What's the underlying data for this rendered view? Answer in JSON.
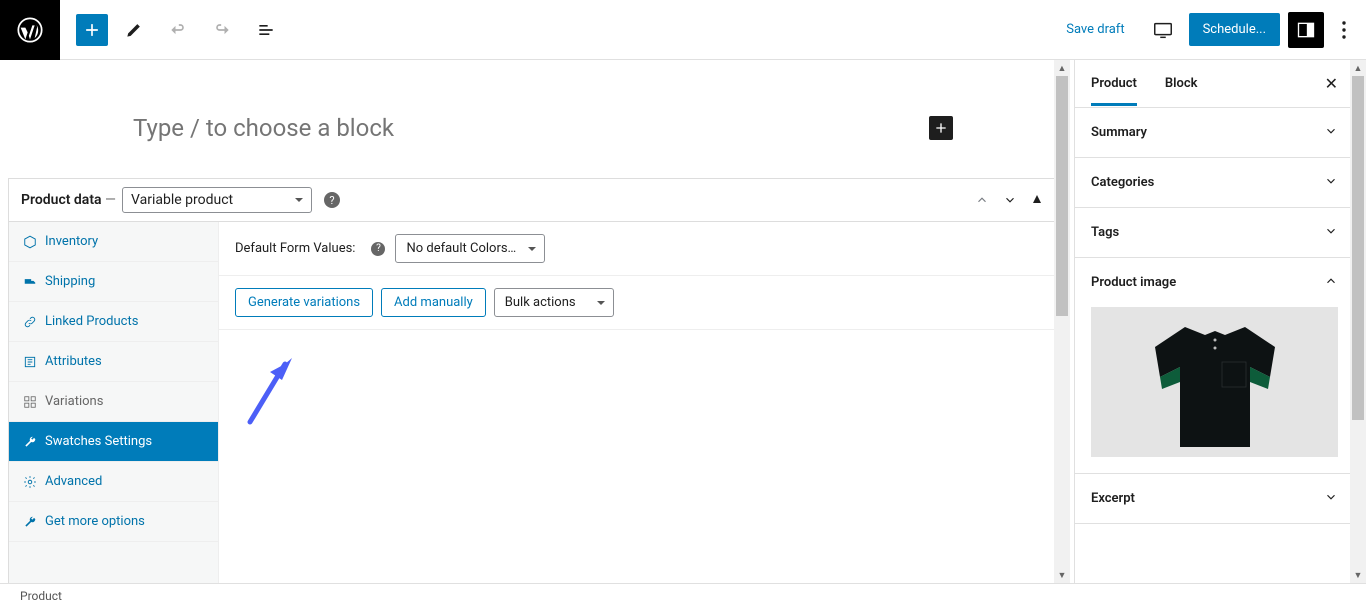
{
  "topbar": {
    "save_draft": "Save draft",
    "schedule": "Schedule..."
  },
  "block": {
    "placeholder": "Type / to choose a block"
  },
  "metabox": {
    "title": "Product data",
    "dash": "—",
    "product_type": "Variable product",
    "tabs": {
      "inventory": "Inventory",
      "shipping": "Shipping",
      "linked": "Linked Products",
      "attributes": "Attributes",
      "variations": "Variations",
      "swatches": "Swatches Settings",
      "advanced": "Advanced",
      "more": "Get more options"
    },
    "row": {
      "default_form": "Default Form Values:",
      "default_select": "No default Colors…",
      "generate": "Generate variations",
      "add_manually": "Add manually",
      "bulk": "Bulk actions"
    }
  },
  "sidebar": {
    "tab_product": "Product",
    "tab_block": "Block",
    "panels": {
      "summary": "Summary",
      "categories": "Categories",
      "tags": "Tags",
      "product_image": "Product image",
      "excerpt": "Excerpt"
    }
  },
  "footer": {
    "breadcrumb": "Product"
  }
}
